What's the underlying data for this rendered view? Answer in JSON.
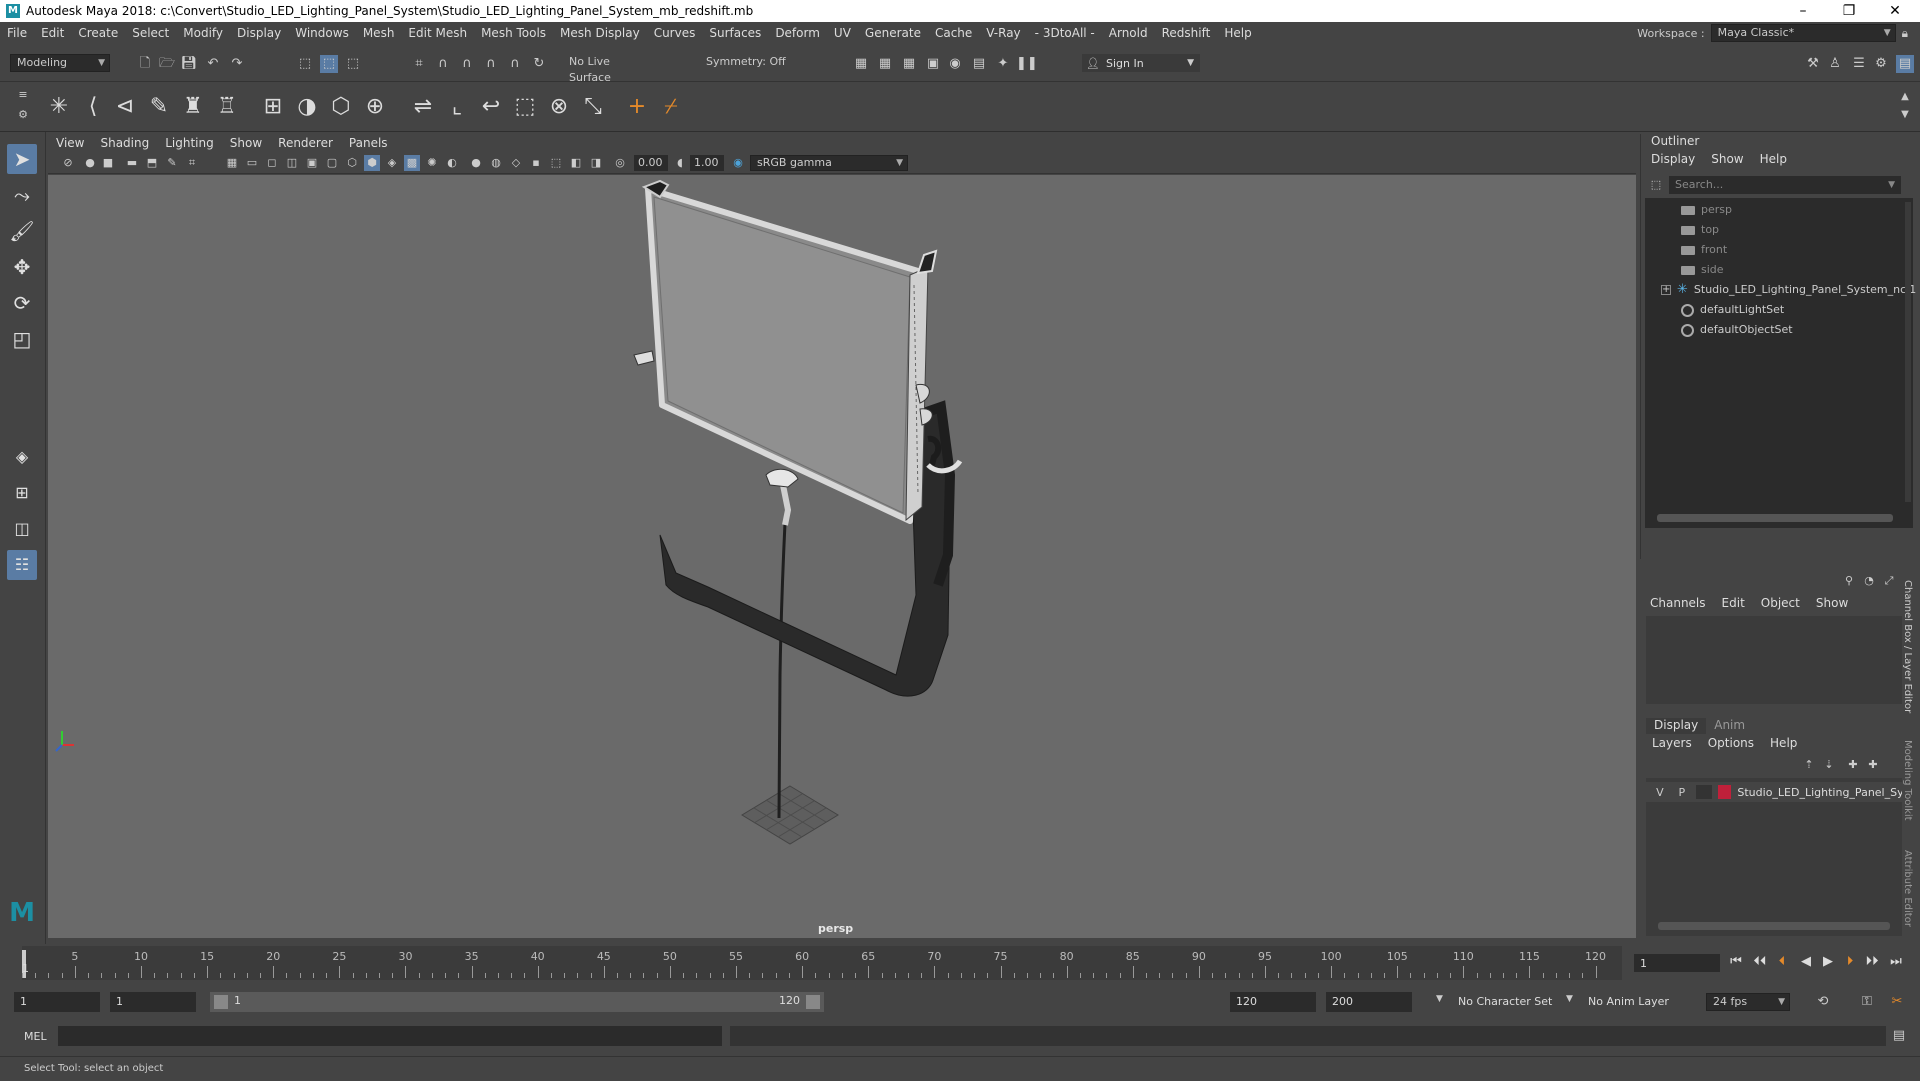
{
  "window": {
    "title": "Autodesk Maya 2018: c:\\Convert\\Studio_LED_Lighting_Panel_System\\Studio_LED_Lighting_Panel_System_mb_redshift.mb",
    "logo_letter": "M"
  },
  "menubar": {
    "items": [
      "File",
      "Edit",
      "Create",
      "Select",
      "Modify",
      "Display",
      "Windows",
      "Mesh",
      "Edit Mesh",
      "Mesh Tools",
      "Mesh Display",
      "Curves",
      "Surfaces",
      "Deform",
      "UV",
      "Generate",
      "Cache",
      "V-Ray",
      "- 3DtoAll -",
      "Arnold",
      "Redshift",
      "Help"
    ],
    "workspace_label": "Workspace :",
    "workspace_value": "Maya Classic*"
  },
  "statusline": {
    "mode": "Modeling",
    "live_surface": "No Live Surface",
    "symmetry": "Symmetry: Off",
    "sign_in": "Sign In"
  },
  "viewport": {
    "menu": [
      "View",
      "Shading",
      "Lighting",
      "Show",
      "Renderer",
      "Panels"
    ],
    "field_a": "0.00",
    "field_b": "1.00",
    "color_space": "sRGB gamma",
    "camera": "persp"
  },
  "outliner": {
    "title": "Outliner",
    "menu": [
      "Display",
      "Show",
      "Help"
    ],
    "search_placeholder": "Search...",
    "items": [
      {
        "label": "persp",
        "type": "camera"
      },
      {
        "label": "top",
        "type": "camera"
      },
      {
        "label": "front",
        "type": "camera"
      },
      {
        "label": "side",
        "type": "camera"
      },
      {
        "label": "Studio_LED_Lighting_Panel_System_ncl1",
        "type": "group"
      },
      {
        "label": "defaultLightSet",
        "type": "set"
      },
      {
        "label": "defaultObjectSet",
        "type": "set"
      }
    ]
  },
  "channelbox": {
    "menu": [
      "Channels",
      "Edit",
      "Object",
      "Show"
    ]
  },
  "layereditor": {
    "tabs": [
      "Display",
      "Anim"
    ],
    "menu": [
      "Layers",
      "Options",
      "Help"
    ],
    "layer": {
      "v": "V",
      "p": "P",
      "name": "Studio_LED_Lighting_Panel_Sy",
      "color": "#c0203a"
    }
  },
  "sidetabs": [
    "Channel Box / Layer Editor",
    "Modeling Toolkit",
    "Attribute Editor"
  ],
  "timeslider": {
    "ticks": [
      "5",
      "10",
      "15",
      "20",
      "25",
      "30",
      "35",
      "40",
      "45",
      "50",
      "55",
      "60",
      "65",
      "70",
      "75",
      "80",
      "85",
      "90",
      "95",
      "100",
      "105",
      "110",
      "115",
      "120"
    ],
    "current_frame_marker": "1",
    "current_frame": "1"
  },
  "range": {
    "start": "1",
    "anim_start": "1",
    "slider_start": "1",
    "slider_end": "120",
    "end": "120",
    "anim_end": "200",
    "character_set": "No Character Set",
    "anim_layer": "No Anim Layer",
    "fps": "24 fps"
  },
  "cmdline": {
    "label": "MEL"
  },
  "helpline": {
    "text": "Select Tool: select an object"
  }
}
